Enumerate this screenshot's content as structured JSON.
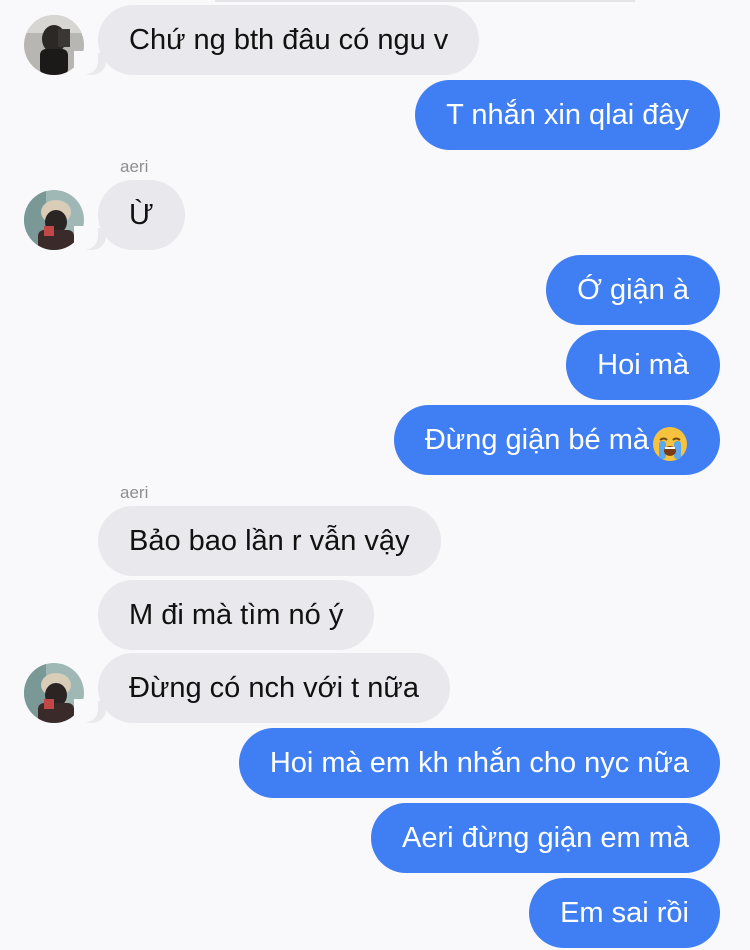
{
  "conversation": {
    "contact_name": "aeri",
    "colors": {
      "incoming_bubble": "#e8e8ed",
      "outgoing_bubble": "#3f7ef3",
      "background": "#f9f9fb",
      "sender_label": "#8e8e93"
    },
    "messages": [
      {
        "direction": "incoming",
        "text": "Chứ ng bth đâu có ngu v"
      },
      {
        "direction": "outgoing",
        "text": "T nhắn xin qlai đây"
      },
      {
        "direction": "incoming",
        "sender": "aeri",
        "text": "Ừ"
      },
      {
        "direction": "outgoing",
        "text": "Ớ giận à"
      },
      {
        "direction": "outgoing",
        "text": "Hoi mà"
      },
      {
        "direction": "outgoing",
        "text": "Đừng giận bé mà",
        "emoji": "loudly-crying-face"
      },
      {
        "direction": "incoming",
        "sender": "aeri",
        "text": "Bảo bao lần r vẫn vậy"
      },
      {
        "direction": "incoming",
        "text": "M đi mà tìm nó ý"
      },
      {
        "direction": "incoming",
        "text": "Đừng có nch với t nữa"
      },
      {
        "direction": "outgoing",
        "text": "Hoi mà em kh nhắn cho nyc nữa"
      },
      {
        "direction": "outgoing",
        "text": "Aeri đừng giận em mà"
      },
      {
        "direction": "outgoing",
        "text": "Em sai rồi"
      }
    ]
  }
}
